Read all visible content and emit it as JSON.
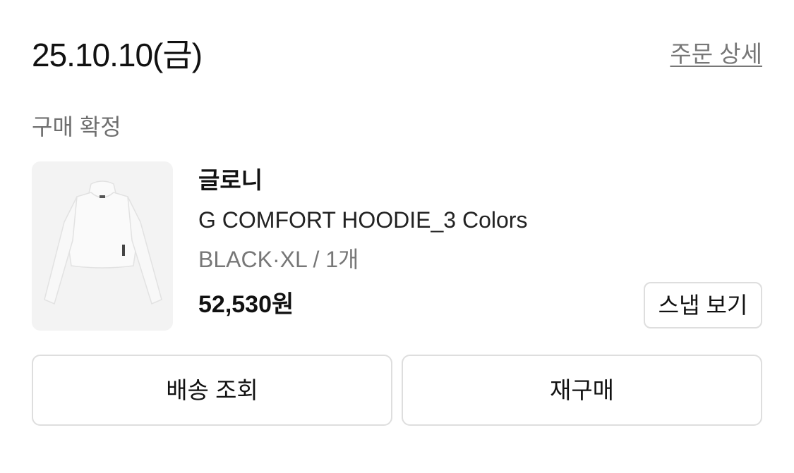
{
  "order": {
    "date": "25.10.10(금)",
    "detail_link": "주문 상세",
    "status": "구매 확정"
  },
  "product": {
    "image_icon": "hoodie-product-image",
    "brand": "글로니",
    "name": "G COMFORT HOODIE_3 Colors",
    "option": "BLACK·XL / 1개",
    "price": "52,530원",
    "snap_button": "스냅 보기"
  },
  "actions": {
    "track_delivery": "배송 조회",
    "rebuy": "재구매"
  },
  "colors": {
    "border": "#dedede",
    "muted_text": "#777777",
    "image_background": "#f3f3f3"
  }
}
